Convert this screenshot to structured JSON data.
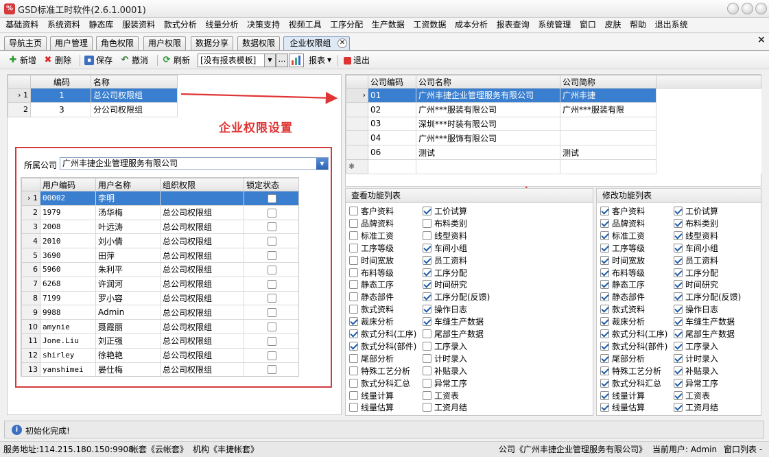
{
  "app": {
    "title": "GSD标准工时软件(2.6.1.0001)",
    "icon_text": "%"
  },
  "menu": [
    "基础资料",
    "系统资料",
    "静态库",
    "服装资料",
    "款式分析",
    "线量分析",
    "决策支持",
    "视频工具",
    "工序分配",
    "生产数据",
    "工资数据",
    "成本分析",
    "报表查询",
    "系统管理",
    "窗口",
    "皮肤",
    "帮助",
    "退出系统"
  ],
  "tabs": [
    "导航主页",
    "用户管理",
    "角色权限",
    "用户权限",
    "数据分享",
    "数据权限",
    "企业权限组"
  ],
  "tab_close": "✕",
  "doc_close": "×",
  "toolbar": {
    "add": "新增",
    "delete": "删除",
    "save": "保存",
    "cancel": "撤消",
    "refresh": "刷新",
    "template_value": "[没有报表模板]",
    "more": "…",
    "report": "报表",
    "exit": "退出"
  },
  "group_grid": {
    "headers": [
      "编码",
      "名称"
    ],
    "rows": [
      {
        "num": "1",
        "code": "1",
        "name": "总公司权限组"
      },
      {
        "num": "2",
        "code": "3",
        "name": "分公司权限组"
      }
    ]
  },
  "annotation": "企业权限设置",
  "company": {
    "label": "所属公司",
    "value": "广州丰捷企业管理服务有限公司"
  },
  "user_grid": {
    "headers": [
      "用户编码",
      "用户名称",
      "组织权限",
      "锁定状态"
    ],
    "rows": [
      {
        "num": "1",
        "code": "00002",
        "name": "李明",
        "group": ""
      },
      {
        "num": "2",
        "code": "1979",
        "name": "汤华梅",
        "group": "总公司权限组"
      },
      {
        "num": "3",
        "code": "2008",
        "name": "叶远涛",
        "group": "总公司权限组"
      },
      {
        "num": "4",
        "code": "2010",
        "name": "刘小倩",
        "group": "总公司权限组"
      },
      {
        "num": "5",
        "code": "3690",
        "name": "田萍",
        "group": "总公司权限组"
      },
      {
        "num": "6",
        "code": "5960",
        "name": "朱利平",
        "group": "总公司权限组"
      },
      {
        "num": "7",
        "code": "6268",
        "name": "许润河",
        "group": "总公司权限组"
      },
      {
        "num": "8",
        "code": "7199",
        "name": "罗小容",
        "group": "总公司权限组"
      },
      {
        "num": "9",
        "code": "9988",
        "name": "Admin",
        "group": "总公司权限组"
      },
      {
        "num": "10",
        "code": "amynie",
        "name": "聂霞丽",
        "group": "总公司权限组"
      },
      {
        "num": "11",
        "code": "Jone.Liu",
        "name": "刘正强",
        "group": "总公司权限组"
      },
      {
        "num": "12",
        "code": "shirley",
        "name": "徐艳艳",
        "group": "总公司权限组"
      },
      {
        "num": "13",
        "code": "yanshimei",
        "name": "晏仕梅",
        "group": "总公司权限组"
      }
    ]
  },
  "company_grid": {
    "headers": [
      "公司编码",
      "公司名称",
      "公司简称"
    ],
    "rows": [
      {
        "code": "01",
        "name": "广州丰捷企业管理服务有限公司",
        "short": "广州丰捷"
      },
      {
        "code": "02",
        "name": "广州***服装有限公司",
        "short": "广州***服装有限"
      },
      {
        "code": "03",
        "name": "深圳***时装有限公司",
        "short": ""
      },
      {
        "code": "04",
        "name": "广州***服饰有限公司",
        "short": ""
      },
      {
        "code": "06",
        "name": "测试",
        "short": "测试"
      }
    ],
    "new_row_marker": "✱"
  },
  "view_panel": {
    "title": "查看功能列表",
    "col1": [
      {
        "label": "客户资料",
        "checked": false
      },
      {
        "label": "品牌资料",
        "checked": false
      },
      {
        "label": "标准工资",
        "checked": false
      },
      {
        "label": "工序等级",
        "checked": false
      },
      {
        "label": "时间宽放",
        "checked": false
      },
      {
        "label": "布料等级",
        "checked": false
      },
      {
        "label": "静态工序",
        "checked": false
      },
      {
        "label": "静态部件",
        "checked": false
      },
      {
        "label": "款式资料",
        "checked": false
      },
      {
        "label": "裁床分析",
        "checked": true
      },
      {
        "label": "款式分科(工序)",
        "checked": true
      },
      {
        "label": "款式分科(部件)",
        "checked": true
      },
      {
        "label": "尾部分析",
        "checked": false
      },
      {
        "label": "特殊工艺分析",
        "checked": false
      },
      {
        "label": "款式分科汇总",
        "checked": false
      },
      {
        "label": "线量计算",
        "checked": false
      },
      {
        "label": "线量估算",
        "checked": false
      }
    ],
    "col2": [
      {
        "label": "工价试算",
        "checked": true
      },
      {
        "label": "布料类别",
        "checked": false
      },
      {
        "label": "线型资料",
        "checked": false
      },
      {
        "label": "车间小组",
        "checked": true
      },
      {
        "label": "员工资料",
        "checked": true
      },
      {
        "label": "工序分配",
        "checked": true
      },
      {
        "label": "时间研究",
        "checked": true
      },
      {
        "label": "工序分配(反馈)",
        "checked": true
      },
      {
        "label": "操作日志",
        "checked": true
      },
      {
        "label": "车缝生产数据",
        "checked": true
      },
      {
        "label": "尾部生产数据",
        "checked": false
      },
      {
        "label": "工序录入",
        "checked": false
      },
      {
        "label": "计时录入",
        "checked": false
      },
      {
        "label": "补贴录入",
        "checked": false
      },
      {
        "label": "异常工序",
        "checked": false
      },
      {
        "label": "工资表",
        "checked": false
      },
      {
        "label": "工资月结",
        "checked": false
      }
    ]
  },
  "edit_panel": {
    "title": "修改功能列表",
    "col1": [
      {
        "label": "客户资料",
        "checked": true
      },
      {
        "label": "品牌资料",
        "checked": true
      },
      {
        "label": "标准工资",
        "checked": true
      },
      {
        "label": "工序等级",
        "checked": true
      },
      {
        "label": "时间宽放",
        "checked": true
      },
      {
        "label": "布料等级",
        "checked": true
      },
      {
        "label": "静态工序",
        "checked": true
      },
      {
        "label": "静态部件",
        "checked": true
      },
      {
        "label": "款式资料",
        "checked": true
      },
      {
        "label": "裁床分析",
        "checked": true
      },
      {
        "label": "款式分科(工序)",
        "checked": true
      },
      {
        "label": "款式分科(部件)",
        "checked": true
      },
      {
        "label": "尾部分析",
        "checked": true
      },
      {
        "label": "特殊工艺分析",
        "checked": true
      },
      {
        "label": "款式分科汇总",
        "checked": true
      },
      {
        "label": "线量计算",
        "checked": true
      },
      {
        "label": "线量估算",
        "checked": true
      }
    ],
    "col2": [
      {
        "label": "工价试算",
        "checked": true
      },
      {
        "label": "布料类别",
        "checked": true
      },
      {
        "label": "线型资料",
        "checked": true
      },
      {
        "label": "车间小组",
        "checked": true
      },
      {
        "label": "员工资料",
        "checked": true
      },
      {
        "label": "工序分配",
        "checked": true
      },
      {
        "label": "时间研究",
        "checked": true
      },
      {
        "label": "工序分配(反馈)",
        "checked": true
      },
      {
        "label": "操作日志",
        "checked": true
      },
      {
        "label": "车缝生产数据",
        "checked": true
      },
      {
        "label": "尾部生产数据",
        "checked": true
      },
      {
        "label": "工序录入",
        "checked": true
      },
      {
        "label": "计时录入",
        "checked": true
      },
      {
        "label": "补贴录入",
        "checked": true
      },
      {
        "label": "异常工序",
        "checked": true
      },
      {
        "label": "工资表",
        "checked": true
      },
      {
        "label": "工资月结",
        "checked": true
      }
    ]
  },
  "status": {
    "icon": "i",
    "text": "初始化完成!"
  },
  "bottom": {
    "server": "服务地址:114.215.180.150:9908",
    "account": "帐套《云帐套》",
    "org": "机构《丰捷帐套》",
    "company": "公司《广州丰捷企业管理服务有限公司》",
    "user": "当前用户: Admin",
    "window_list": "窗口列表 -"
  },
  "colors": {
    "selection": "#3a7fcf",
    "annotation": "#e03535",
    "accent": "#2b63b5"
  }
}
